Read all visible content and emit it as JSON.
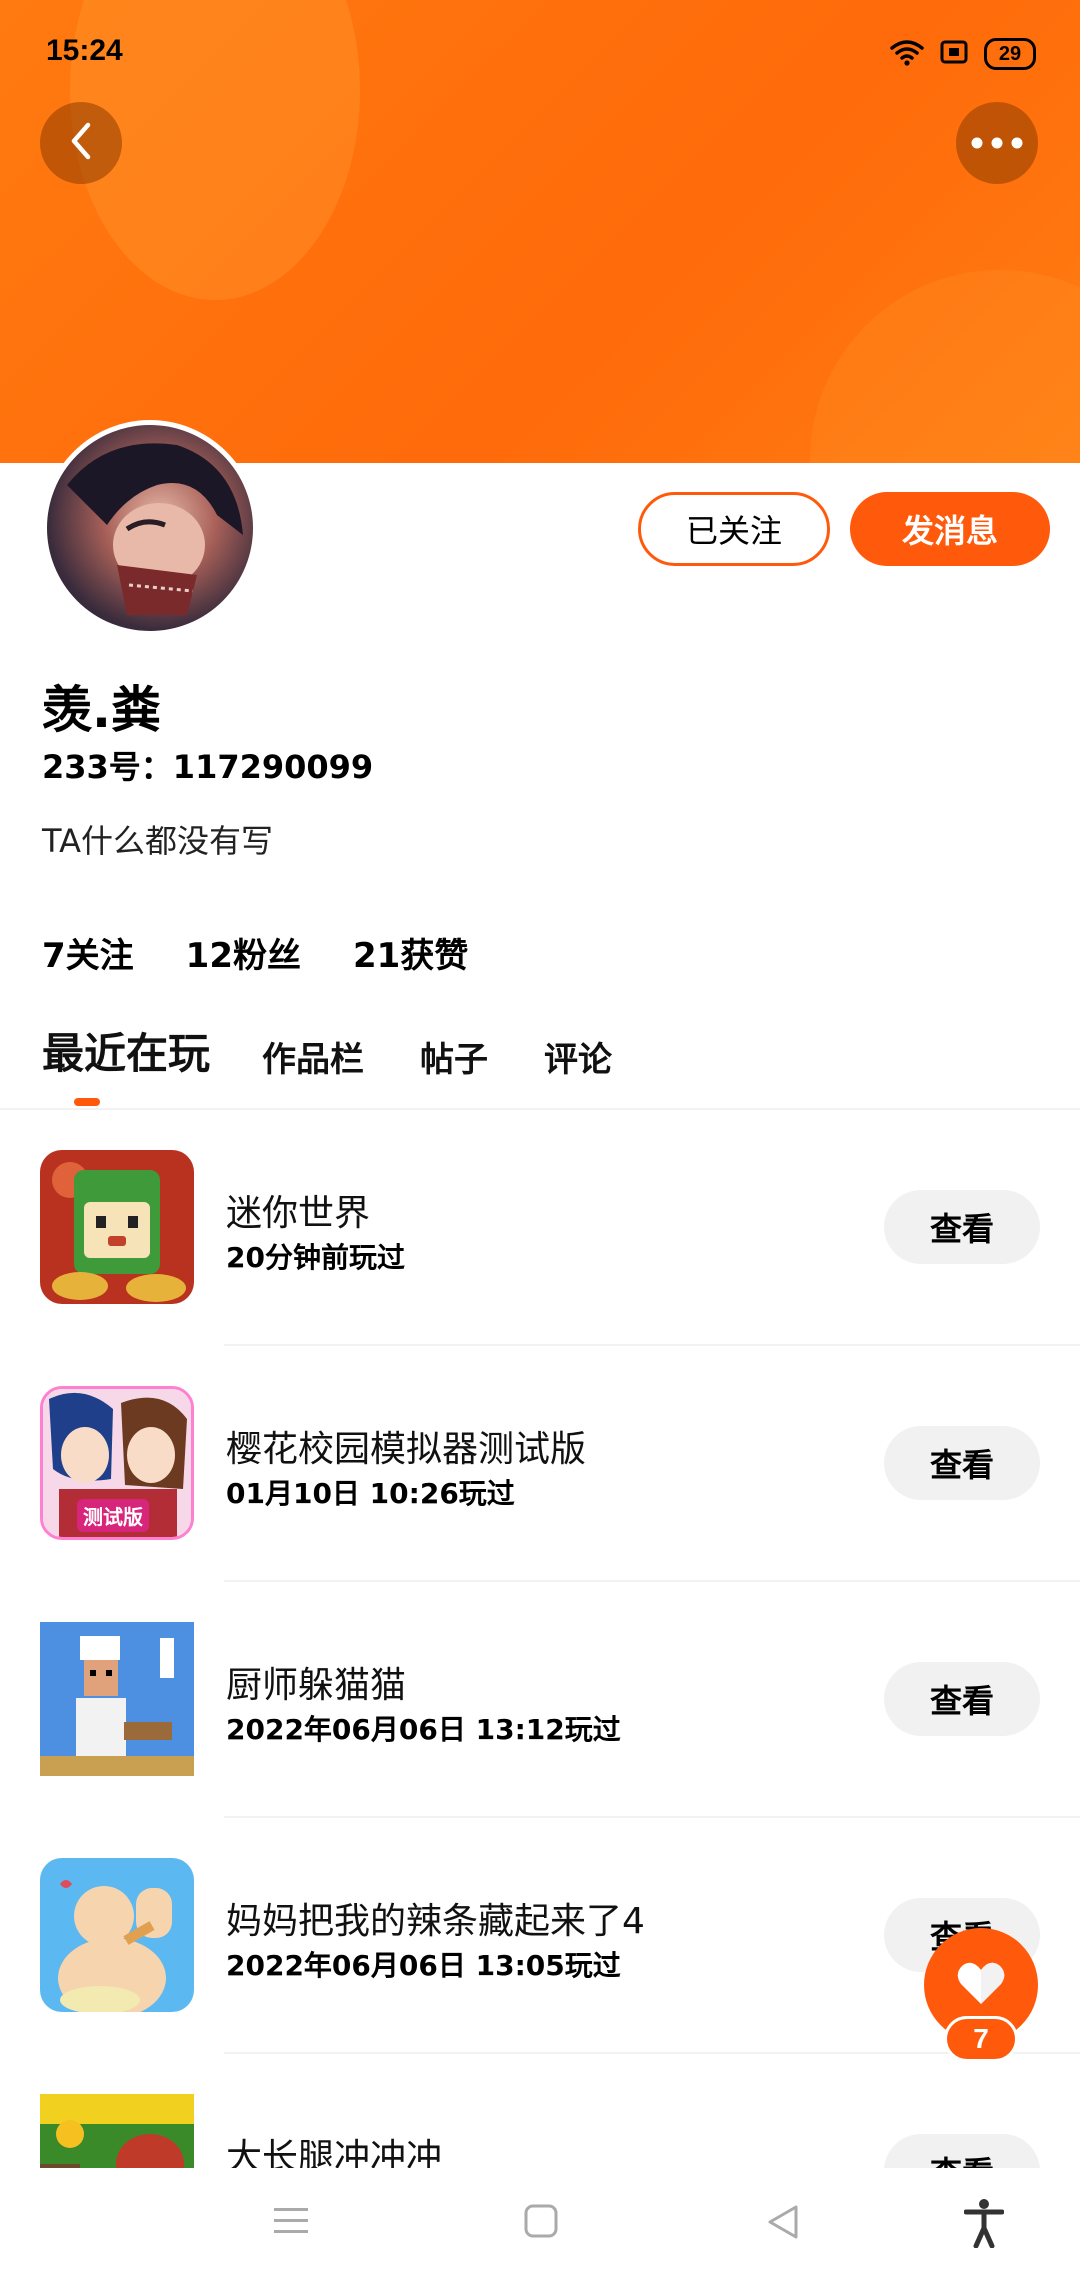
{
  "status_bar": {
    "time": "15:24",
    "battery": "29",
    "icons": [
      "wifi-icon",
      "sim-icon",
      "battery-icon"
    ]
  },
  "header": {
    "back_icon": "chevron-left-icon",
    "more_icon": "more-horizontal-icon",
    "accent_color": "#ff6a0a"
  },
  "profile": {
    "name": "羡.粪",
    "id_text": "233号：117290099",
    "bio": "TA什么都没有写",
    "follow_button": "已关注",
    "message_button": "发消息",
    "stats": {
      "following": "7关注",
      "fans": "12粉丝",
      "likes": "21获赞"
    }
  },
  "tabs": [
    {
      "label": "最近在玩",
      "active": true
    },
    {
      "label": "作品栏",
      "active": false
    },
    {
      "label": "帖子",
      "active": false
    },
    {
      "label": "评论",
      "active": false
    }
  ],
  "games": [
    {
      "title": "迷你世界",
      "time": "20分钟前玩过",
      "button": "查看"
    },
    {
      "title": "樱花校园模拟器测试版",
      "time": "01月10日 10:26玩过",
      "button": "查看",
      "icon_badge": "测试版"
    },
    {
      "title": "厨师躲猫猫",
      "time": "2022年06月06日 13:12玩过",
      "button": "查看"
    },
    {
      "title": "妈妈把我的辣条藏起来了4",
      "time": "2022年06月06日 13:05玩过",
      "button": "查看"
    },
    {
      "title": "大长腿冲冲冲",
      "time": "",
      "button": "查看"
    }
  ],
  "like_fab": {
    "count": "7"
  },
  "navbar": {
    "icons": [
      "menu-icon",
      "home-square-icon",
      "back-triangle-icon",
      "accessibility-icon"
    ]
  }
}
